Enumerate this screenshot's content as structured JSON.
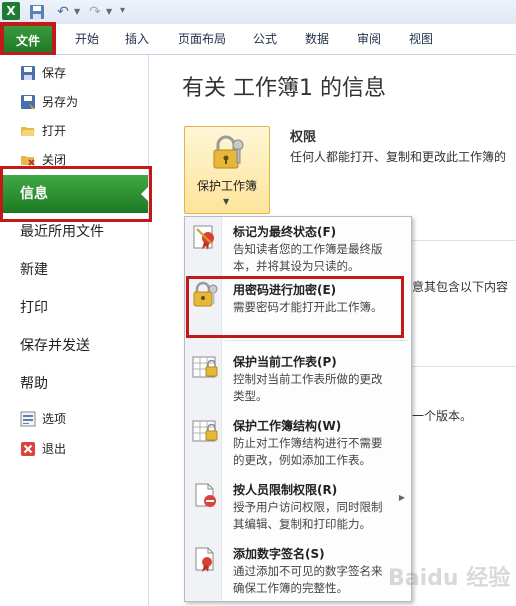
{
  "qat": {
    "logo_text": "X"
  },
  "tabs": [
    "文件",
    "开始",
    "插入",
    "页面布局",
    "公式",
    "数据",
    "审阅",
    "视图"
  ],
  "left_menu": {
    "save": "保存",
    "save_as": "另存为",
    "open": "打开",
    "close": "关闭",
    "info": "信息",
    "recent": "最近所用文件",
    "new": "新建",
    "print": "打印",
    "save_send": "保存并发送",
    "help": "帮助",
    "options": "选项",
    "exit": "退出"
  },
  "main": {
    "heading": "有关 工作簿1 的信息",
    "protect_button": "保护工作簿",
    "permissions_title": "权限",
    "permissions_desc": "任何人都能打开、复制和更改此工作簿的",
    "partial_text_1": "注意其包含以下内容",
    "partial_text_2": "上一个版本。"
  },
  "dropdown": {
    "items": [
      {
        "title": "标记为最终状态(F)",
        "desc": [
          "告知读者您的工作簿是最终版",
          "本，并将其设为只读的。"
        ],
        "icon": "final-ribbon-icon"
      },
      {
        "title": "用密码进行加密(E)",
        "desc": [
          "需要密码才能打开此工作簿。"
        ],
        "icon": "lock-key-icon"
      },
      {
        "title": "保护当前工作表(P)",
        "desc": [
          "控制对当前工作表所做的更改",
          "类型。"
        ],
        "icon": "sheet-lock-icon"
      },
      {
        "title": "保护工作簿结构(W)",
        "desc": [
          "防止对工作簿结构进行不需要",
          "的更改，例如添加工作表。"
        ],
        "icon": "workbook-lock-icon"
      },
      {
        "title": "按人员限制权限(R)",
        "desc": [
          "授予用户访问权限，同时限制",
          "其编辑、复制和打印能力。"
        ],
        "icon": "restrict-permission-icon"
      },
      {
        "title": "添加数字签名(S)",
        "desc": [
          "通过添加不可见的数字签名来",
          "确保工作簿的完整性。"
        ],
        "icon": "digital-signature-icon"
      }
    ]
  },
  "watermark": "Baidu 经验",
  "colors": {
    "accent_green": "#1f7a25",
    "highlight_red": "#c01a1a",
    "button_gold": "#fde49a"
  }
}
